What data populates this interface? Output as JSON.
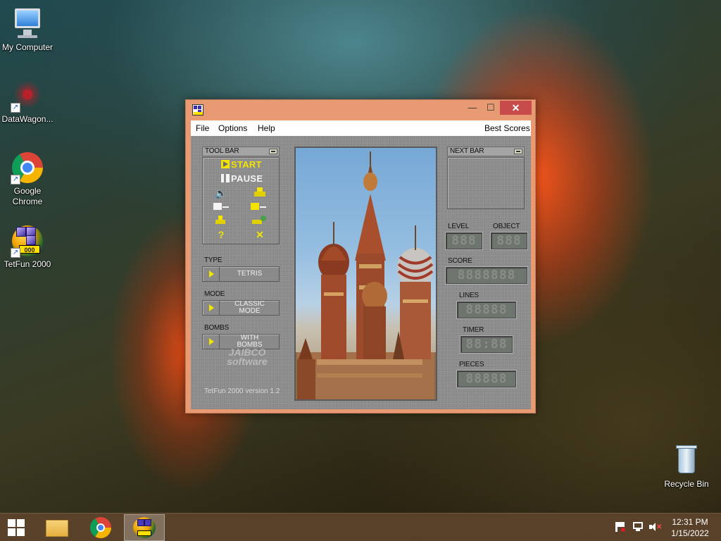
{
  "desktop": {
    "icons": [
      {
        "label": "My Computer",
        "icon": "computer-icon"
      },
      {
        "label": "DataWagon...",
        "icon": "datawagon-icon"
      },
      {
        "label": "Google Chrome",
        "icon": "chrome-icon"
      },
      {
        "label": "TetFun 2000",
        "icon": "tetfun-icon"
      },
      {
        "label": "Recycle Bin",
        "icon": "recycle-bin-icon"
      }
    ]
  },
  "window": {
    "title_icon": "tetfun-app-icon",
    "controls": {
      "minimize": "—",
      "maximize": "☐",
      "close": "✕"
    },
    "menu": {
      "file": "File",
      "options": "Options",
      "help": "Help",
      "best_scores": "Best Scores"
    },
    "toolbar": {
      "header": "TOOL BAR",
      "start": "START",
      "pause": "PAUSE",
      "icons": [
        "sound-icon",
        "blocks-icon",
        "load-icon",
        "save-icon",
        "stack-icon",
        "stack-add-icon",
        "help-icon",
        "exit-icon"
      ]
    },
    "type": {
      "header": "TYPE",
      "value": "TETRIS"
    },
    "mode": {
      "header": "MODE",
      "value": "CLASSIC MODE"
    },
    "bombs": {
      "header": "BOMBS",
      "value": "WITH BOMBS"
    },
    "logo": {
      "line1": "JAIBCO",
      "line2": "software"
    },
    "version": "TetFun 2000 version 1.2",
    "next_bar": {
      "header": "NEXT BAR"
    },
    "stats": {
      "level": {
        "label": "LEVEL",
        "value": "888"
      },
      "object": {
        "label": "OBJECT",
        "value": "888"
      },
      "score": {
        "label": "SCORE",
        "value": "8888888"
      },
      "lines": {
        "label": "LINES",
        "value": "88888"
      },
      "timer": {
        "label": "TIMER",
        "value": "88:88"
      },
      "pieces": {
        "label": "PIECES",
        "value": "88888"
      }
    }
  },
  "taskbar": {
    "clock": {
      "time": "12:31 PM",
      "date": "1/15/2022"
    },
    "tray_icons": [
      "flag-icon",
      "network-icon",
      "volume-muted-icon"
    ]
  },
  "colors": {
    "window_frame": "#e89a72",
    "close_button": "#c74b4b",
    "accent_yellow": "#f2e400",
    "panel_gray": "#8c8c8c"
  }
}
